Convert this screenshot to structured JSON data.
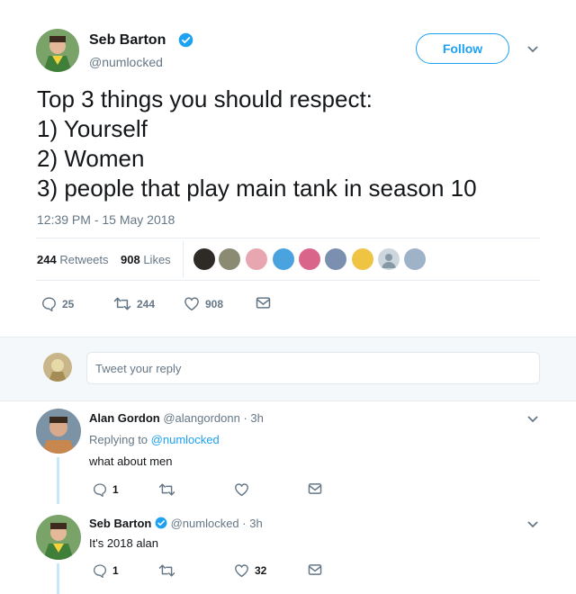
{
  "tweet": {
    "author_name": "Seb Barton",
    "author_handle": "@numlocked",
    "follow_label": "Follow",
    "text_lines": [
      "Top 3 things you should respect:",
      "1) Yourself",
      "2) Women",
      "3) people that play main tank in season 10"
    ],
    "timestamp": "12:39 PM - 15 May 2018",
    "retweets_count": "244",
    "retweets_label": "Retweets",
    "likes_count": "908",
    "likes_label": "Likes",
    "actions": {
      "replies": "25",
      "retweets": "244",
      "likes": "908"
    }
  },
  "reply_box": {
    "placeholder": "Tweet your reply"
  },
  "replies": [
    {
      "name": "Alan Gordon",
      "handle": "@alangordonn",
      "time": "· 3h",
      "replying_to_label": "Replying to",
      "replying_to": "@numlocked",
      "text": "what about men",
      "reply_count": "1",
      "retweet_count": "",
      "like_count": ""
    },
    {
      "name": "Seb Barton",
      "handle": "@numlocked",
      "time": "· 3h",
      "text": "It's 2018 alan",
      "reply_count": "1",
      "retweet_count": "",
      "like_count": "32"
    }
  ],
  "colors": {
    "accent": "#1da1f2",
    "muted": "#657786",
    "divider": "#e6ecf0",
    "background_alt": "#f5f8fa"
  },
  "icons": [
    "verified-badge-icon",
    "chevron-down-icon",
    "reply-icon",
    "retweet-icon",
    "like-icon",
    "message-icon"
  ]
}
